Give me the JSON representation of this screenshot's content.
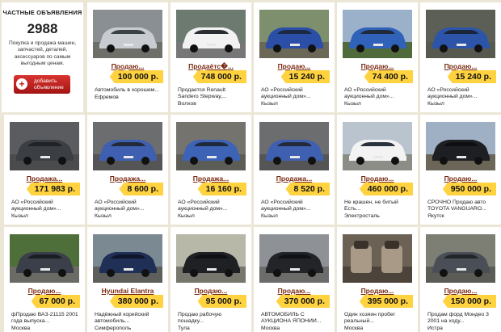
{
  "info": {
    "header": "ЧАСТНЫЕ ОБЪЯВЛЕНИЯ",
    "count": "2988",
    "text": "Покупка и продажа машин, запчастей, деталей, аксессуаров по самым выгодным ценам.",
    "add_button_line1": "добавить",
    "add_button_line2": "объявление",
    "plus_icon": "+"
  },
  "cards": [
    {
      "title": "Продаю...",
      "price": "100 000 р.",
      "desc": "Автомобиль в хорошем...",
      "loc": "Ефремов",
      "photo": "silver-sedan"
    },
    {
      "title": "Продаётс�...",
      "price": "748 000 р.",
      "desc": "Продается Renault Sandero Stepway,...",
      "loc": "Волхов",
      "photo": "white-hatch"
    },
    {
      "title": "Продаю...",
      "price": "15 240 р.",
      "desc": "АО «Российский аукционный дом»...",
      "loc": "Кызыл",
      "photo": "blue-van"
    },
    {
      "title": "Продаю...",
      "price": "74 400 р.",
      "desc": "АО «Российский аукционный дом»...",
      "loc": "Кызыл",
      "photo": "blue-truck"
    },
    {
      "title": "Продаю...",
      "price": "15 240 р.",
      "desc": "АО «Российский аукционный дом»...",
      "loc": "Кызыл",
      "photo": "blue-van-post"
    },
    {
      "title": "Продажа...",
      "price": "171 983 р.",
      "desc": "АО «Российский аукционный дом»...",
      "loc": "Кызыл",
      "photo": "dark-sedan"
    },
    {
      "title": "Продажа...",
      "price": "8 600 р.",
      "desc": "АО «Российский аукционный дом»...",
      "loc": "Кызыл",
      "photo": "blue-car"
    },
    {
      "title": "Продажа...",
      "price": "16 160 р.",
      "desc": "АО «Российский аукционный дом»...",
      "loc": "Кызыл",
      "photo": "blue-minivan"
    },
    {
      "title": "Продажа...",
      "price": "8 520 р.",
      "desc": "АО «Российский аукционный дом»...",
      "loc": "Кызыл",
      "photo": "blue-car"
    },
    {
      "title": "Продаю...",
      "price": "460 000 р.",
      "desc": "Не крашен, не битый Есть...",
      "loc": "Электросталь",
      "photo": "white-sedan"
    },
    {
      "title": "Продаю...",
      "price": "950 000 р.",
      "desc": "СРОЧНО Продаю авто TOYOTA VANGUARO...",
      "loc": "Якутск",
      "photo": "black-suv"
    },
    {
      "title": "Продаю...",
      "price": "67 000 р.",
      "desc": "фПродаю ВАЗ-21115 2001 года выпуска...",
      "loc": "Москва",
      "photo": "dark-sedan-trees"
    },
    {
      "title": "Hyundai Elantra",
      "price": "380 000 р.",
      "desc": "Надёжный корейский автомобиль...",
      "loc": "Симферополь",
      "photo": "navy-hatch"
    },
    {
      "title": "Продаю...",
      "price": "95 000 р.",
      "desc": "Продаю рабочую пошадку...",
      "loc": "Тула",
      "photo": "black-sedan-house"
    },
    {
      "title": "Продаю...",
      "price": "370 000 р.",
      "desc": "АВТОМОБИЛЬ С АУКЦИОНА ЯПОНИИ...",
      "loc": "Москва",
      "photo": "black-minivan"
    },
    {
      "title": "Продаю...",
      "price": "395 000 р.",
      "desc": "Один хозяин пробег реальный...",
      "loc": "Москва",
      "photo": "interior"
    },
    {
      "title": "Продаю...",
      "price": "150 000 р.",
      "desc": "Продам форд Мондео 3 2001 на ходу...",
      "loc": "Истра",
      "photo": "grey-sedan"
    }
  ]
}
